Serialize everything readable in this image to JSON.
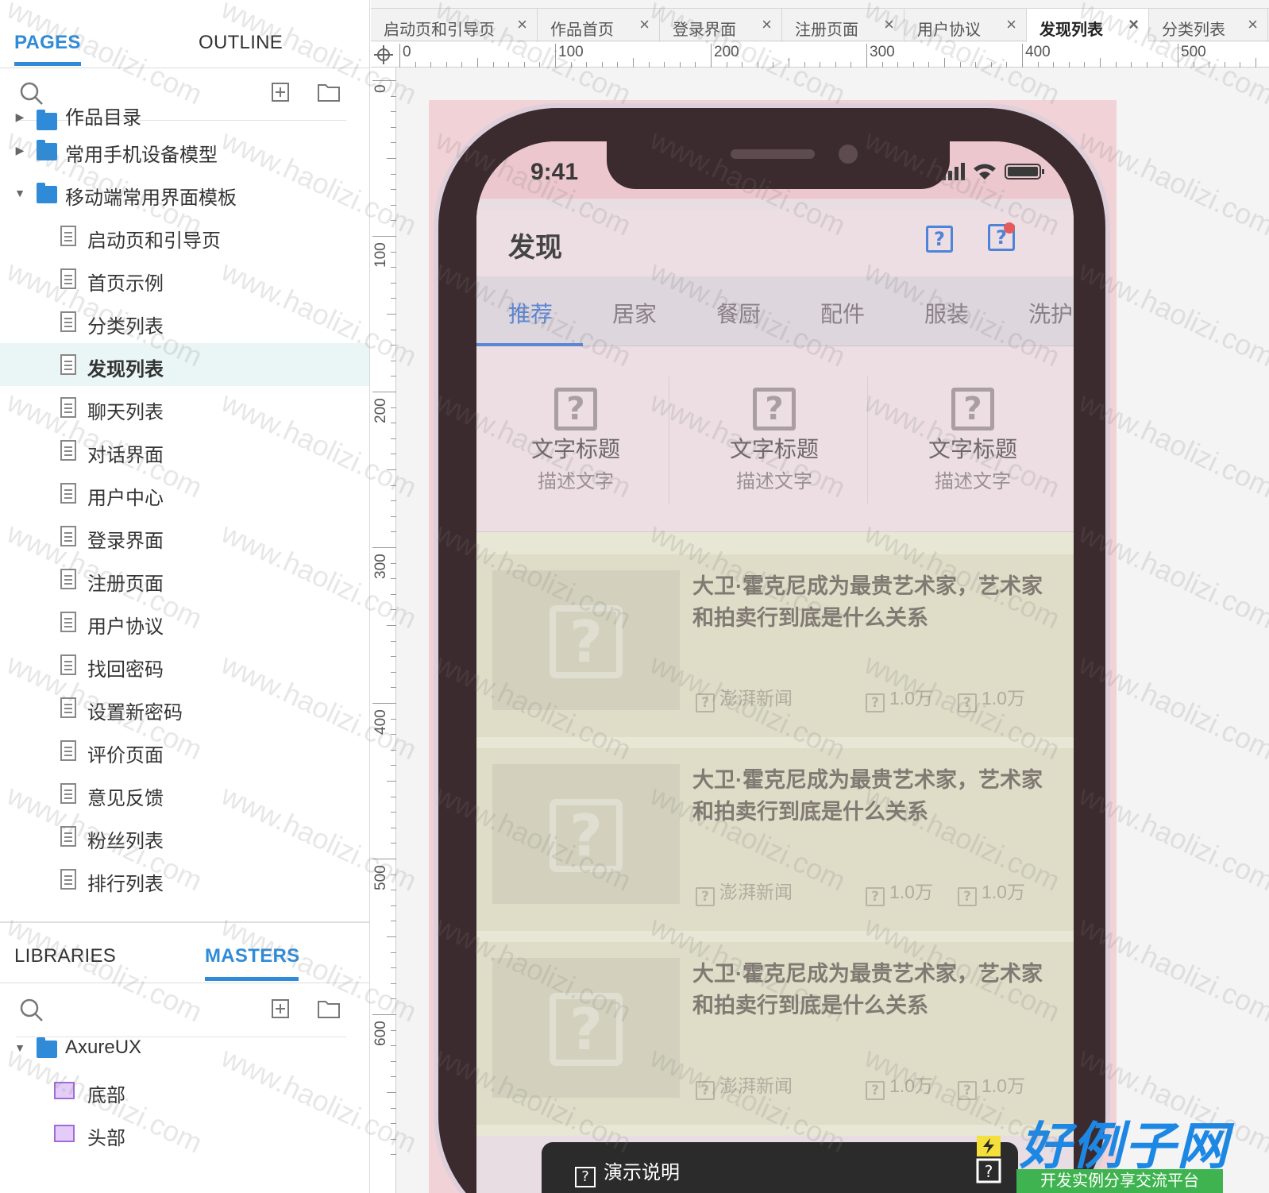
{
  "left_panel": {
    "pages_tab": "PAGES",
    "outline_tab": "OUTLINE",
    "tree": [
      {
        "label": "作品目录",
        "type": "folder",
        "level": 0,
        "arrow": "collapsed",
        "partial": true
      },
      {
        "label": "常用手机设备模型",
        "type": "folder",
        "level": 0,
        "arrow": "collapsed"
      },
      {
        "label": "移动端常用界面模板",
        "type": "folder",
        "level": 0,
        "arrow": "expanded"
      },
      {
        "label": "启动页和引导页",
        "type": "page",
        "level": 1
      },
      {
        "label": "首页示例",
        "type": "page",
        "level": 1
      },
      {
        "label": "分类列表",
        "type": "page",
        "level": 1
      },
      {
        "label": "发现列表",
        "type": "page",
        "level": 1,
        "selected": true
      },
      {
        "label": "聊天列表",
        "type": "page",
        "level": 1
      },
      {
        "label": "对话界面",
        "type": "page",
        "level": 1
      },
      {
        "label": "用户中心",
        "type": "page",
        "level": 1
      },
      {
        "label": "登录界面",
        "type": "page",
        "level": 1
      },
      {
        "label": "注册页面",
        "type": "page",
        "level": 1
      },
      {
        "label": "用户协议",
        "type": "page",
        "level": 1
      },
      {
        "label": "找回密码",
        "type": "page",
        "level": 1
      },
      {
        "label": "设置新密码",
        "type": "page",
        "level": 1
      },
      {
        "label": "评价页面",
        "type": "page",
        "level": 1
      },
      {
        "label": "意见反馈",
        "type": "page",
        "level": 1
      },
      {
        "label": "粉丝列表",
        "type": "page",
        "level": 1
      },
      {
        "label": "排行列表",
        "type": "page",
        "level": 1
      }
    ],
    "libraries_tab": "LIBRARIES",
    "masters_tab": "MASTERS",
    "masters_tree": [
      {
        "label": "AxureUX",
        "type": "folder",
        "level": 0,
        "arrow": "expanded"
      },
      {
        "label": "底部",
        "type": "master",
        "level": 1
      },
      {
        "label": "头部",
        "type": "master",
        "level": 1
      }
    ]
  },
  "doc_tabs": [
    {
      "label": "启动页和引导页"
    },
    {
      "label": "作品首页"
    },
    {
      "label": "登录界面"
    },
    {
      "label": "注册页面"
    },
    {
      "label": "用户协议"
    },
    {
      "label": "发现列表",
      "active": true
    },
    {
      "label": "分类列表"
    }
  ],
  "ruler": {
    "h_labels": [
      "0",
      "100",
      "200",
      "300",
      "400",
      "500"
    ],
    "v_labels": [
      "0",
      "100",
      "200",
      "300",
      "400",
      "500",
      "600"
    ]
  },
  "phone": {
    "time": "9:41",
    "nav_title": "发现",
    "categories": [
      "推荐",
      "居家",
      "餐厨",
      "配件",
      "服装",
      "洗护"
    ],
    "active_category": "推荐",
    "features": [
      {
        "title": "文字标题",
        "desc": "描述文字"
      },
      {
        "title": "文字标题",
        "desc": "描述文字"
      },
      {
        "title": "文字标题",
        "desc": "描述文字"
      }
    ],
    "news": [
      {
        "title": "大卫·霍克尼成为最贵艺术家，艺术家和拍卖行到底是什么关系",
        "source": "澎湃新闻",
        "views": "1.0万",
        "likes": "1.0万"
      },
      {
        "title": "大卫·霍克尼成为最贵艺术家，艺术家和拍卖行到底是什么关系",
        "source": "澎湃新闻",
        "views": "1.0万",
        "likes": "1.0万"
      },
      {
        "title": "大卫·霍克尼成为最贵艺术家，艺术家和拍卖行到底是什么关系",
        "source": "澎湃新闻",
        "views": "1.0万",
        "likes": "1.0万"
      }
    ],
    "icon_glyph": "?"
  },
  "popup": {
    "label": "演示说明"
  },
  "logo": {
    "title": "好例子网",
    "subtitle": "开发实例分享交流平台"
  },
  "watermark": "www.haolizi.com",
  "colors": {
    "accent": "#2f8bd8",
    "tab_active": "#5b86d6",
    "badge": "#e55b5b"
  }
}
